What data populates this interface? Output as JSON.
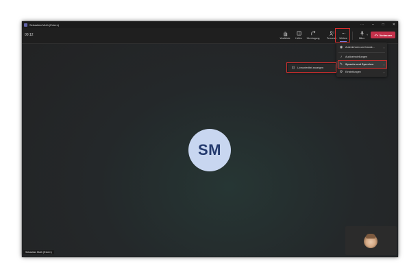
{
  "window": {
    "title": "Sebastian Muth (Extern)",
    "controls": [
      "⋯",
      "–",
      "□",
      "✕"
    ]
  },
  "toolbar": {
    "timer": "00:12",
    "buttons": [
      {
        "label": "Wortleiste",
        "icon": "raise-hand-icon"
      },
      {
        "label": "Helfen",
        "icon": "chat-icon"
      },
      {
        "label": "Übertragung",
        "icon": "share-icon"
      },
      {
        "label": "Personen",
        "icon": "people-icon",
        "badge": "2"
      },
      {
        "label": "Weitere",
        "icon": "more-icon"
      },
      {
        "label": "Mikro",
        "icon": "microphone-icon"
      }
    ],
    "leave_label": "Verlassen"
  },
  "more_menu": {
    "items": [
      {
        "label": "Aufzeichnen und transk...",
        "icon": "record-icon",
        "has_submenu": true
      },
      {
        "label": "Audioeinstellungen",
        "icon": "audio-settings-icon",
        "has_submenu": false
      },
      {
        "label": "Sprache und Sprechen",
        "icon": "language-icon",
        "has_submenu": true
      },
      {
        "label": "Einstellungen",
        "icon": "settings-icon",
        "has_submenu": true
      }
    ]
  },
  "submenu": {
    "label": "Liveuntertitel anzeigen"
  },
  "participant": {
    "initials": "SM",
    "name_tag": "Sebastian Muth (Extern)"
  },
  "colors": {
    "accent_red": "#d9302f",
    "leave_red": "#c4314b",
    "avatar_bg": "#c8d6f0",
    "avatar_text": "#243a6e",
    "teams_purple": "#6264a7"
  }
}
